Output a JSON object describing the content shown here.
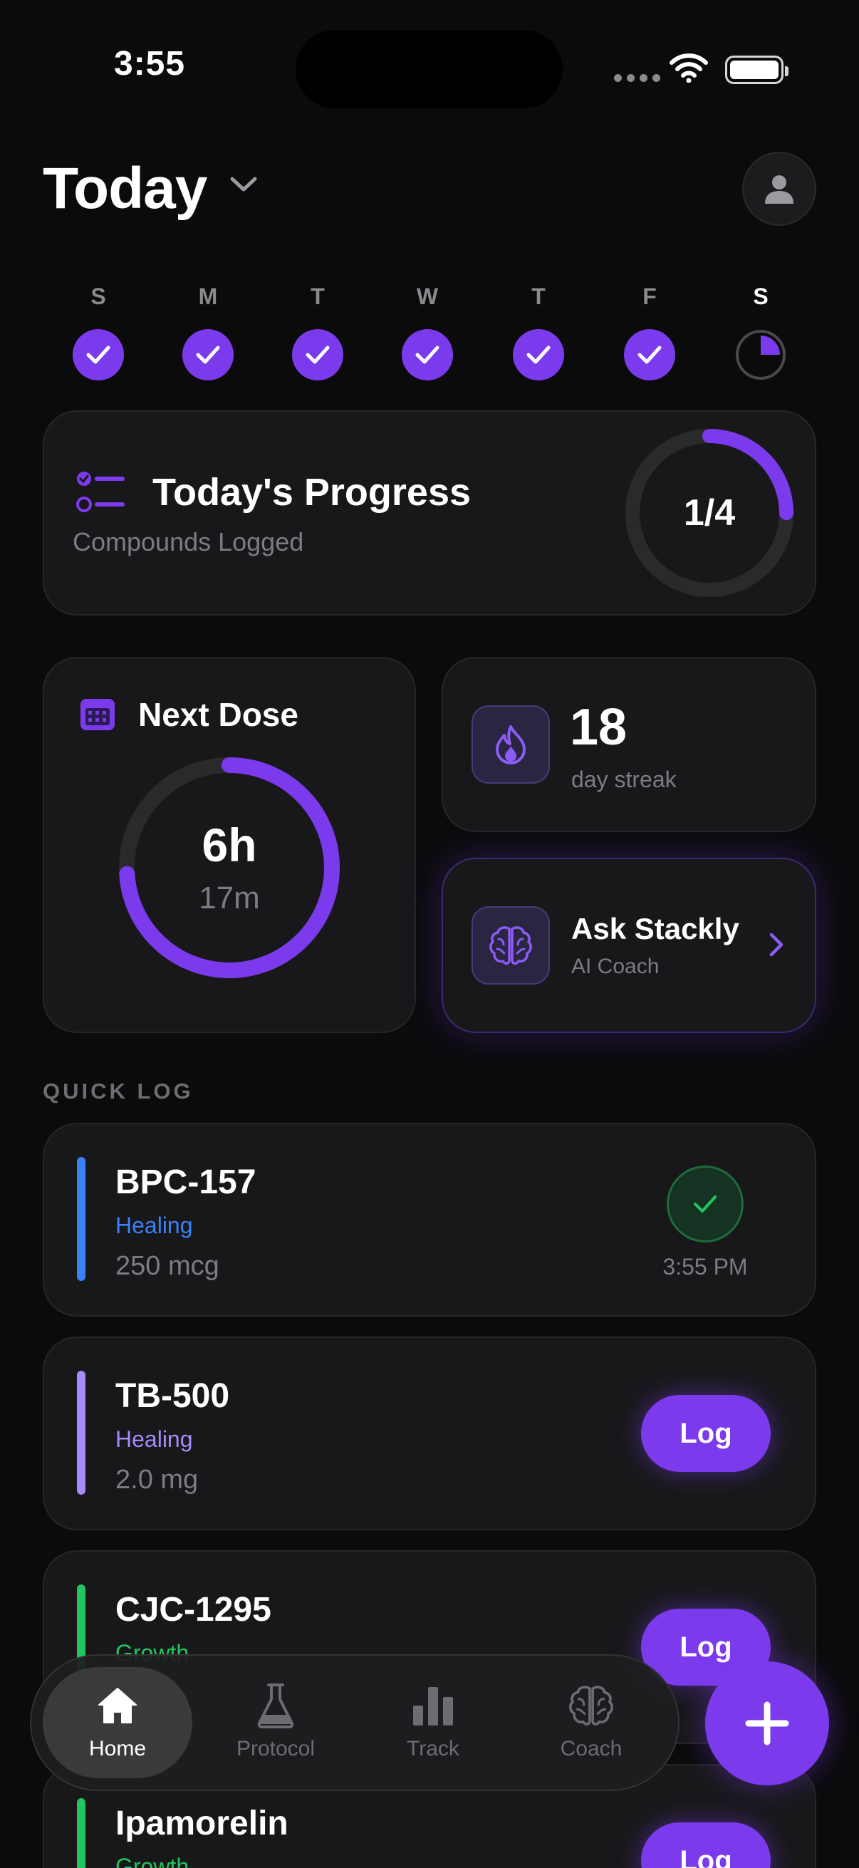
{
  "status_bar": {
    "time": "3:55"
  },
  "header": {
    "title": "Today"
  },
  "week": {
    "days": [
      "S",
      "M",
      "T",
      "W",
      "T",
      "F",
      "S"
    ],
    "completed": [
      true,
      true,
      true,
      true,
      true,
      true,
      false
    ],
    "today_index": 6,
    "today_fraction": 0.25
  },
  "progress": {
    "title": "Today's Progress",
    "subtitle": "Compounds Logged",
    "value": "1/4",
    "fraction": 0.25
  },
  "next_dose": {
    "title": "Next Dose",
    "hours": "6h",
    "minutes": "17m",
    "fraction": 0.74
  },
  "streak": {
    "value": "18",
    "label": "day streak"
  },
  "ask": {
    "title": "Ask Stackly",
    "subtitle": "AI Coach"
  },
  "quick_log": {
    "section_label": "QUICK LOG",
    "items": [
      {
        "name": "BPC-157",
        "category": "Healing",
        "dose": "250 mcg",
        "status": "done",
        "time": "3:55 PM",
        "color": "#3b82f6"
      },
      {
        "name": "TB-500",
        "category": "Healing",
        "dose": "2.0 mg",
        "status": "pending",
        "button": "Log",
        "color": "#a78bfa"
      },
      {
        "name": "CJC-1295",
        "category": "Growth",
        "dose": "",
        "status": "pending",
        "button": "Log",
        "color": "#22c55e"
      },
      {
        "name": "Ipamorelin",
        "category": "Growth",
        "dose": "",
        "status": "pending",
        "button": "Log",
        "color": "#22c55e"
      }
    ]
  },
  "tabs": [
    {
      "label": "Home",
      "icon": "home-icon",
      "active": true
    },
    {
      "label": "Protocol",
      "icon": "flask-icon",
      "active": false
    },
    {
      "label": "Track",
      "icon": "bar-chart-icon",
      "active": false
    },
    {
      "label": "Coach",
      "icon": "brain-icon",
      "active": false
    }
  ],
  "colors": {
    "accent": "#7c3aed",
    "background": "#0b0b0c",
    "card": "#18181a",
    "success": "#22c55e"
  }
}
